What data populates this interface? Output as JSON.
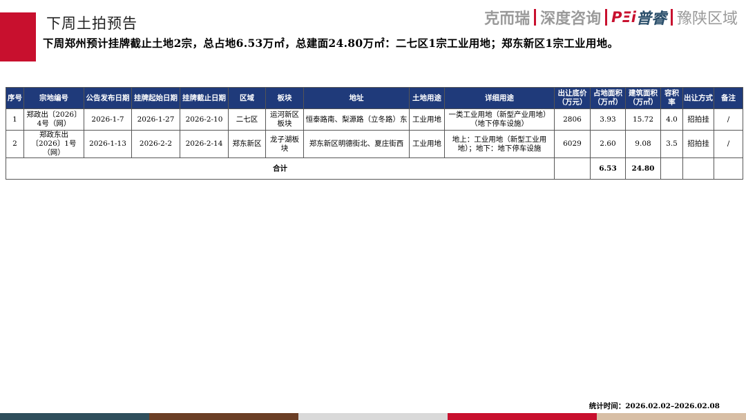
{
  "header": {
    "title": "下周土拍预告",
    "subtitle": "下周郑州预计挂牌截止土地2宗，总占地6.53万㎡，总建面24.80万㎡：二七区1宗工业用地；郑东新区1宗工业用地。"
  },
  "logo": {
    "part1": "克而瑞",
    "part2": "深度咨询",
    "part3_mark": "PΞi",
    "part3_name": "普睿",
    "part4": "豫陕区域"
  },
  "table": {
    "headers": [
      "序号",
      "宗地编号",
      "公告发布日期",
      "挂牌起始日期",
      "挂牌截止日期",
      "区域",
      "板块",
      "地址",
      "土地用途",
      "详细用途",
      "出让底价（万元）",
      "占地面积（万㎡）",
      "建筑面积（万㎡）",
      "容积率",
      "出让方式",
      "备注"
    ],
    "rows": [
      [
        "1",
        "郑政出〔2026〕4号（网）",
        "2026-1-7",
        "2026-1-27",
        "2026-2-10",
        "二七区",
        "运河新区板块",
        "恒泰路南、梨源路（立冬路）东",
        "工业用地",
        "一类工业用地（新型产业用地）（地下停车设施）",
        "2806",
        "3.93",
        "15.72",
        "4.0",
        "招拍挂",
        "/"
      ],
      [
        "2",
        "郑政东出〔2026〕1号（网）",
        "2026-1-13",
        "2026-2-2",
        "2026-2-14",
        "郑东新区",
        "龙子湖板块",
        "郑东新区明德街北、夏庄街西",
        "工业用地",
        "地上：工业用地（新型工业用地）；地下：地下停车设施",
        "6029",
        "2.60",
        "9.08",
        "3.5",
        "招拍挂",
        "/"
      ]
    ],
    "total": {
      "label": "合计",
      "land_area": "6.53",
      "build_area": "24.80"
    }
  },
  "footnote": "统计时间：2026.02.02–2026.02.08",
  "colors": {
    "accent_red": "#c8102e",
    "header_blue": "#1f3a7a",
    "bar": [
      "#2f4f5c",
      "#6b3f26",
      "#d9d9d9",
      "#c8102e",
      "#d8bfa6"
    ]
  }
}
